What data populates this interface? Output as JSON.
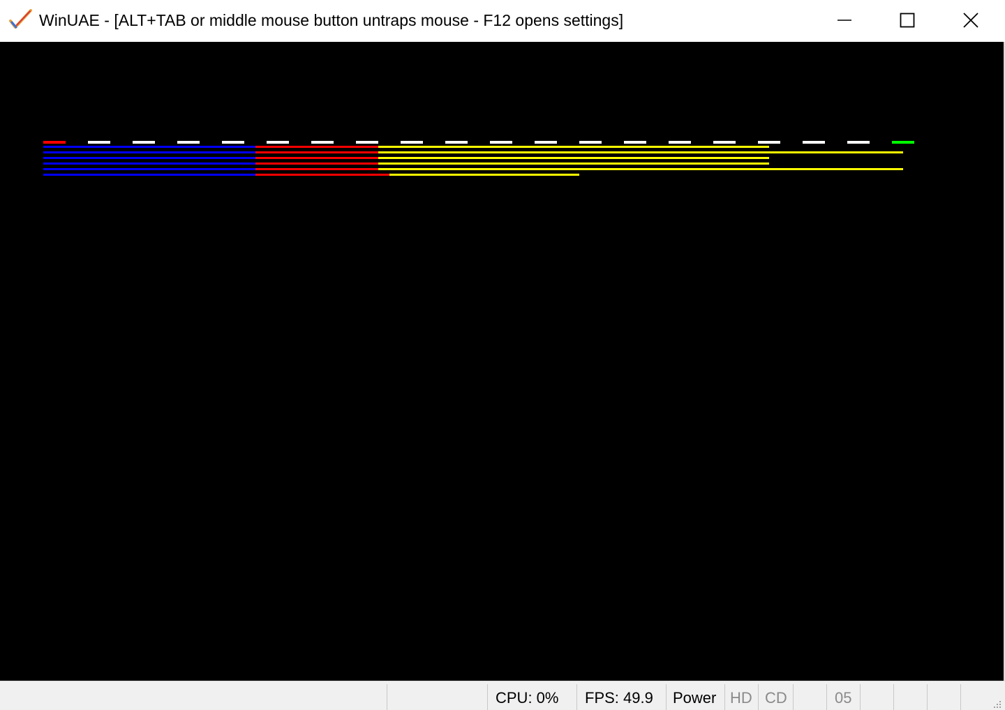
{
  "window": {
    "title": "WinUAE - [ALT+TAB or middle mouse button untraps mouse - F12 opens settings]",
    "app_icon": "winuae-checkmark-icon",
    "controls": {
      "minimize_icon": "minimize-icon",
      "maximize_icon": "maximize-icon",
      "close_icon": "close-icon"
    }
  },
  "display": {
    "background_color": "#000000",
    "colors": {
      "blue": "#0000ff",
      "red": "#ff0000",
      "yellow": "#ffff00",
      "white": "#ffffff",
      "green": "#00ff00"
    }
  },
  "statusbar": {
    "cpu": "CPU: 0%",
    "fps": "FPS: 49.9",
    "power": "Power",
    "hd": "HD",
    "cd": "CD",
    "drive_counter": "05",
    "resize_grip_icon": "resize-grip-icon"
  }
}
